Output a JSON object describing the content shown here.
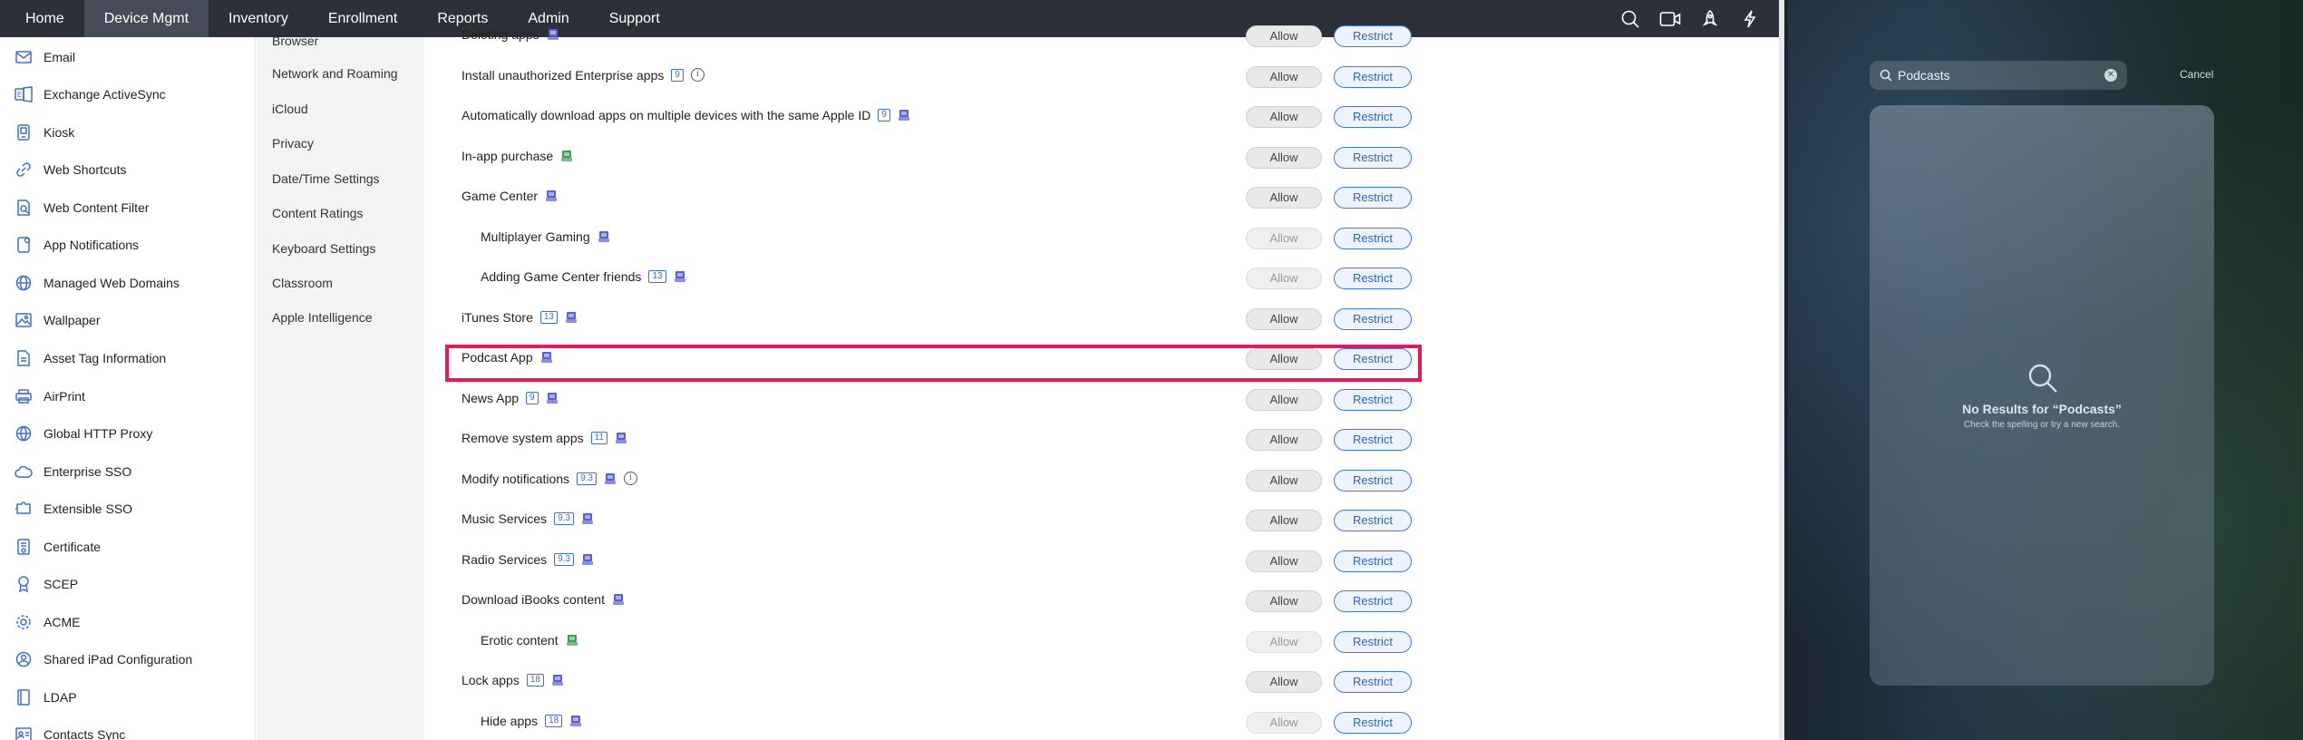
{
  "nav": {
    "items": [
      "Home",
      "Device Mgmt",
      "Inventory",
      "Enrollment",
      "Reports",
      "Admin",
      "Support"
    ],
    "active": "Device Mgmt",
    "icons": [
      "search-icon",
      "video-icon",
      "rocket-icon",
      "lightning-icon"
    ]
  },
  "sidebar": {
    "items": [
      {
        "label": "Email",
        "icon": "email-icon"
      },
      {
        "label": "Exchange ActiveSync",
        "icon": "exchange-icon"
      },
      {
        "label": "Kiosk",
        "icon": "kiosk-icon"
      },
      {
        "label": "Web Shortcuts",
        "icon": "link-icon"
      },
      {
        "label": "Web Content Filter",
        "icon": "filter-icon"
      },
      {
        "label": "App Notifications",
        "icon": "notification-icon"
      },
      {
        "label": "Managed Web Domains",
        "icon": "globe-icon"
      },
      {
        "label": "Wallpaper",
        "icon": "image-icon"
      },
      {
        "label": "Asset Tag Information",
        "icon": "tag-icon"
      },
      {
        "label": "AirPrint",
        "icon": "printer-icon"
      },
      {
        "label": "Global HTTP Proxy",
        "icon": "proxy-icon"
      },
      {
        "label": "Enterprise SSO",
        "icon": "cloud-icon"
      },
      {
        "label": "Extensible SSO",
        "icon": "puzzle-icon"
      },
      {
        "label": "Certificate",
        "icon": "certificate-icon"
      },
      {
        "label": "SCEP",
        "icon": "badge-icon"
      },
      {
        "label": "ACME",
        "icon": "settings-icon"
      },
      {
        "label": "Shared iPad Configuration",
        "icon": "shared-icon"
      },
      {
        "label": "LDAP",
        "icon": "book-icon"
      },
      {
        "label": "Contacts Sync",
        "icon": "contacts-icon"
      }
    ]
  },
  "subnav": {
    "items": [
      "Browser",
      "Network and Roaming",
      "iCloud",
      "Privacy",
      "Date/Time Settings",
      "Content Ratings",
      "Keyboard Settings",
      "Classroom",
      "Apple Intelligence"
    ]
  },
  "restrictions": {
    "allow_label": "Allow",
    "restrict_label": "Restrict",
    "rows": [
      {
        "label": "Deleting apps",
        "indent": false,
        "version": "",
        "device": "blue",
        "info": false,
        "allow_dim": false
      },
      {
        "label": "Install unauthorized Enterprise apps",
        "indent": false,
        "version": "9",
        "device": "",
        "info": true,
        "allow_dim": false
      },
      {
        "label": "Automatically download apps on multiple devices with the same Apple ID",
        "indent": false,
        "version": "9",
        "device": "blue",
        "info": false,
        "allow_dim": false
      },
      {
        "label": "In-app purchase",
        "indent": false,
        "version": "",
        "device": "green",
        "info": false,
        "allow_dim": false
      },
      {
        "label": "Game Center",
        "indent": false,
        "version": "",
        "device": "blue",
        "info": false,
        "allow_dim": false
      },
      {
        "label": "Multiplayer Gaming",
        "indent": true,
        "version": "",
        "device": "blue",
        "info": false,
        "allow_dim": true
      },
      {
        "label": "Adding Game Center friends",
        "indent": true,
        "version": "13",
        "device": "blue",
        "info": false,
        "allow_dim": true
      },
      {
        "label": "iTunes Store",
        "indent": false,
        "version": "13",
        "device": "blue",
        "info": false,
        "allow_dim": false
      },
      {
        "label": "Podcast App",
        "indent": false,
        "version": "",
        "device": "blue",
        "info": false,
        "allow_dim": false
      },
      {
        "label": "News App",
        "indent": false,
        "version": "9",
        "device": "blue",
        "info": false,
        "allow_dim": false
      },
      {
        "label": "Remove system apps",
        "indent": false,
        "version": "11",
        "device": "blue",
        "info": false,
        "allow_dim": false
      },
      {
        "label": "Modify notifications",
        "indent": false,
        "version": "9.3",
        "device": "blue",
        "info": true,
        "allow_dim": false
      },
      {
        "label": "Music Services",
        "indent": false,
        "version": "9.3",
        "device": "blue",
        "info": false,
        "allow_dim": false
      },
      {
        "label": "Radio Services",
        "indent": false,
        "version": "9.3",
        "device": "blue",
        "info": false,
        "allow_dim": false
      },
      {
        "label": "Download iBooks content",
        "indent": false,
        "version": "",
        "device": "blue",
        "info": false,
        "allow_dim": false
      },
      {
        "label": "Erotic content",
        "indent": true,
        "version": "",
        "device": "green",
        "info": false,
        "allow_dim": true
      },
      {
        "label": "Lock apps",
        "indent": false,
        "version": "18",
        "device": "blue",
        "info": false,
        "allow_dim": false
      },
      {
        "label": "Hide apps",
        "indent": true,
        "version": "18",
        "device": "blue",
        "info": false,
        "allow_dim": true
      }
    ],
    "highlighted_row": "Podcast App"
  },
  "ipad": {
    "search_query": "Podcasts",
    "cancel_label": "Cancel",
    "no_results": "No Results for “Podcasts”",
    "hint": "Check the spelling or try a new search."
  },
  "colors": {
    "nav_bg": "#2c3039",
    "accent": "#3f6dd6",
    "highlight": "#e8195a"
  }
}
